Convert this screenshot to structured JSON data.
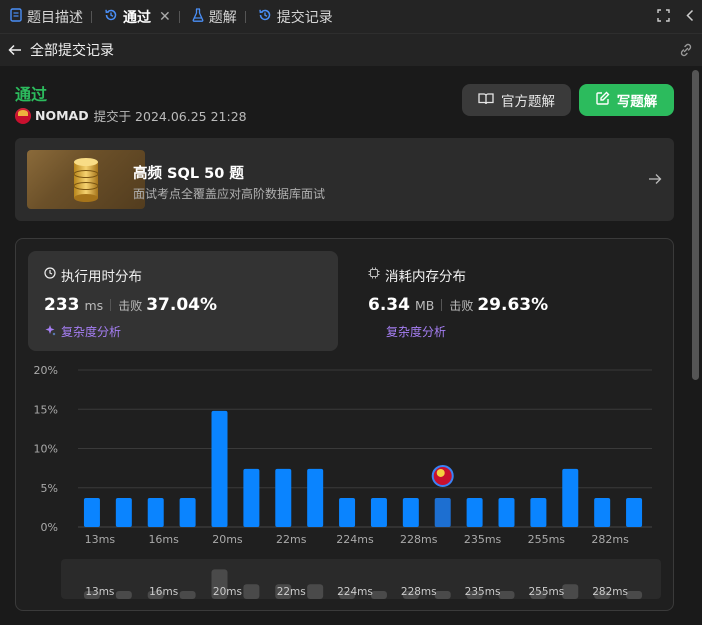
{
  "tabs": [
    {
      "label": "题目描述",
      "icon": "document-icon",
      "color": "#4a8ff7"
    },
    {
      "label": "通过",
      "icon": "history-icon",
      "color": "#4a8ff7",
      "active": true
    },
    {
      "label": "题解",
      "icon": "flask-icon",
      "color": "#4a8ff7"
    },
    {
      "label": "提交记录",
      "icon": "history-icon",
      "color": "#4a8ff7"
    }
  ],
  "header": {
    "title": "全部提交记录"
  },
  "submission": {
    "status": "通过",
    "username": "NOMAD",
    "submitted_text": "提交于 2024.06.25 21:28"
  },
  "buttons": {
    "official": "官方题解",
    "write": "写题解"
  },
  "banner": {
    "title": "高频 SQL 50 题",
    "subtitle": "面试考点全覆盖应对高阶数据库面试"
  },
  "runtime": {
    "title": "执行用时分布",
    "value": "233",
    "unit": "ms",
    "beat_label": "击败",
    "beat_pct": "37.04%",
    "complexity": "复杂度分析"
  },
  "memory": {
    "title": "消耗内存分布",
    "value": "6.34",
    "unit": "MB",
    "beat_label": "击败",
    "beat_pct": "29.63%",
    "complexity": "复杂度分析"
  },
  "colors": {
    "accent": "#2cbb5d",
    "bar": "#0a84ff",
    "bar_mine": "#1d6fd1",
    "purple": "#a57ef3"
  },
  "chart_data": {
    "type": "bar",
    "yticks": [
      "20%",
      "15%",
      "10%",
      "5%",
      "0%"
    ],
    "ylim": [
      0,
      20
    ],
    "values": [
      3.7,
      3.7,
      3.7,
      3.7,
      14.8,
      7.4,
      7.4,
      7.4,
      3.7,
      3.7,
      3.7,
      3.7,
      3.7,
      3.7,
      3.7,
      7.4,
      3.7,
      3.7
    ],
    "mine_index": 11,
    "xtick_labels": [
      "13ms",
      "16ms",
      "20ms",
      "22ms",
      "224ms",
      "228ms",
      "235ms",
      "255ms",
      "282ms"
    ],
    "grid": true
  },
  "mini_chart": {
    "labels": [
      "13ms",
      "16ms",
      "20ms",
      "22ms",
      "224ms",
      "228ms",
      "235ms",
      "255ms",
      "282ms"
    ]
  }
}
